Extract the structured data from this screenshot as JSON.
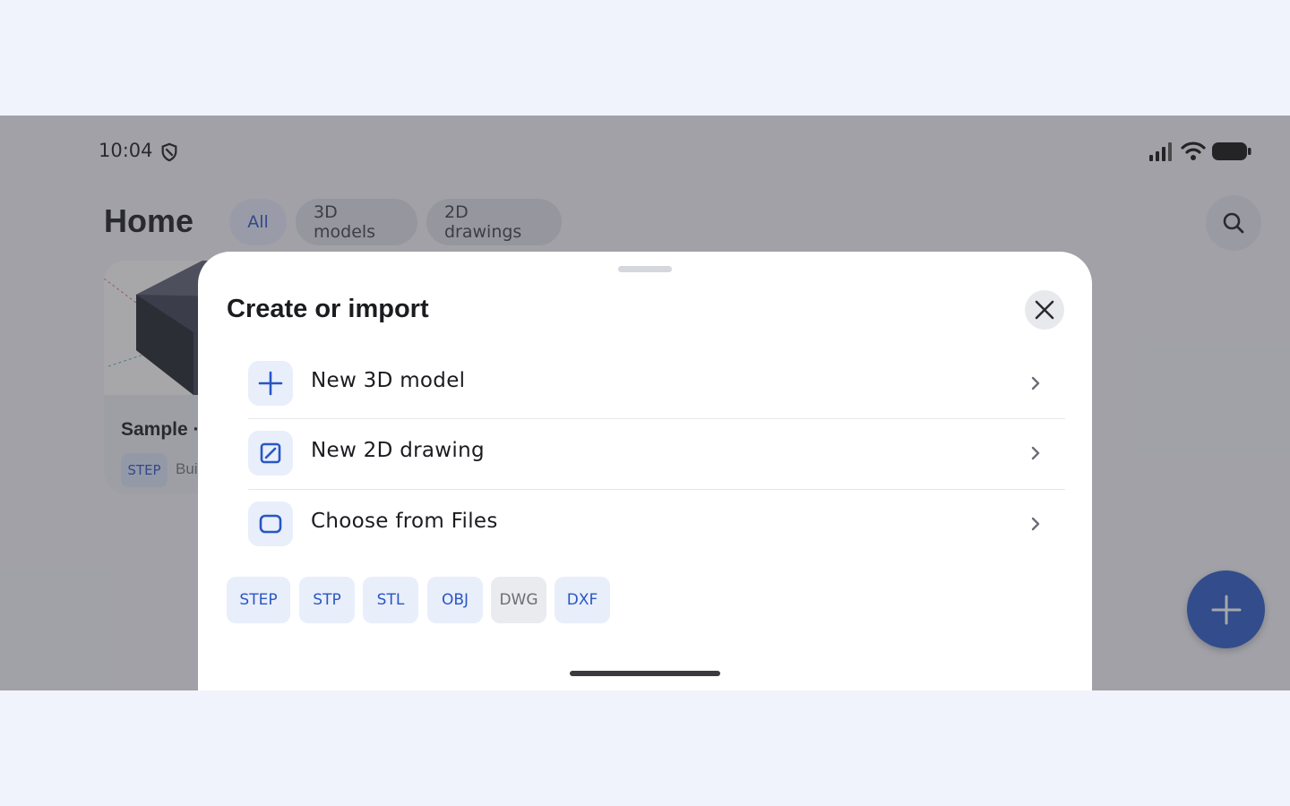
{
  "status_bar": {
    "time": "10:04"
  },
  "header": {
    "title": "Home",
    "chips": [
      {
        "label": "All",
        "active": true
      },
      {
        "label": "3D models",
        "active": false
      },
      {
        "label": "2D drawings",
        "active": false
      }
    ]
  },
  "card": {
    "title": "Sample ·",
    "badge": "STEP",
    "meta": "Bui"
  },
  "sheet": {
    "title": "Create or import",
    "items": [
      {
        "label": "New 3D model",
        "icon": "plus-icon"
      },
      {
        "label": "New 2D drawing",
        "icon": "edit-square-icon"
      },
      {
        "label": "Choose from Files",
        "icon": "folder-square-icon"
      }
    ],
    "formats": [
      {
        "label": "STEP"
      },
      {
        "label": "STP"
      },
      {
        "label": "STL"
      },
      {
        "label": "OBJ"
      },
      {
        "label": "DWG"
      },
      {
        "label": "DXF"
      }
    ]
  },
  "colors": {
    "accent": "#2857c4",
    "fab": "#2b5ac8",
    "scrim": "#3c3c42"
  }
}
